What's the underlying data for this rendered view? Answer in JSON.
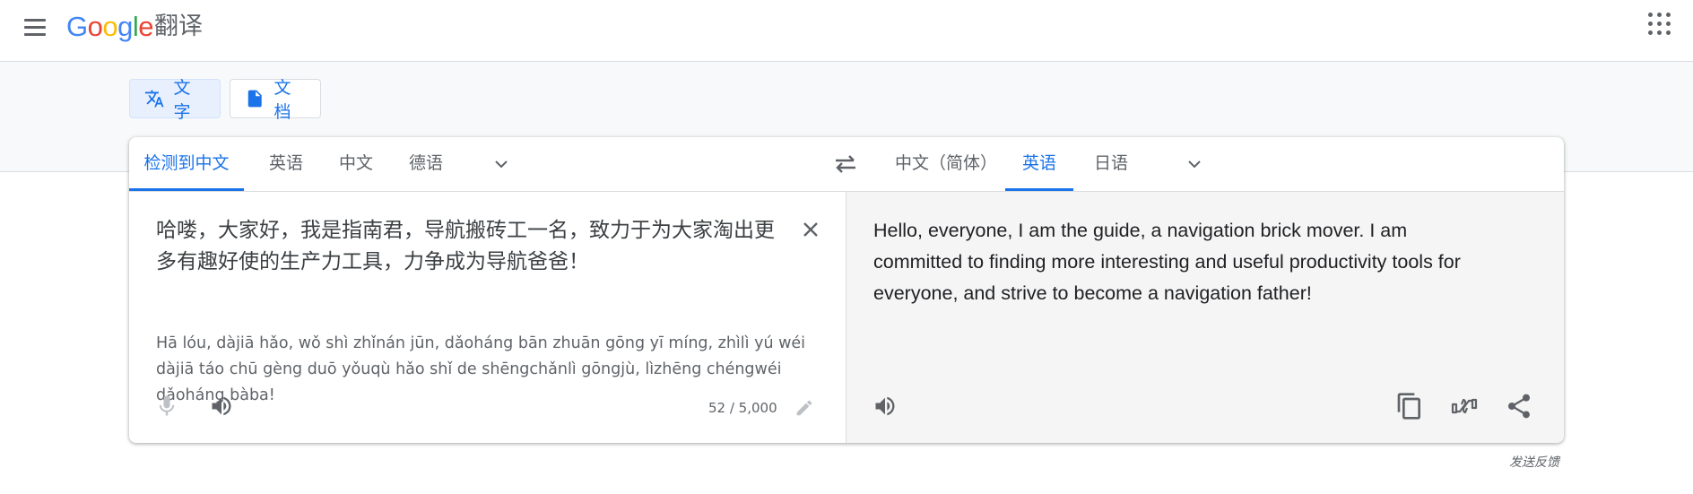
{
  "header": {
    "logo": {
      "g1": "G",
      "o1": "o",
      "o2": "o",
      "g2": "g",
      "l": "l",
      "e": "e"
    },
    "product_name": "翻译"
  },
  "modes": [
    {
      "label": "文字",
      "icon": "translate-icon",
      "active": true
    },
    {
      "label": "文档",
      "icon": "document-icon",
      "active": false
    }
  ],
  "source_langs": [
    {
      "label": "检测到中文",
      "active": true
    },
    {
      "label": "英语",
      "active": false
    },
    {
      "label": "中文",
      "active": false
    },
    {
      "label": "德语",
      "active": false
    }
  ],
  "target_langs": [
    {
      "label": "中文（简体）",
      "active": false
    },
    {
      "label": "英语",
      "active": true
    },
    {
      "label": "日语",
      "active": false
    }
  ],
  "source": {
    "text": "哈喽，大家好，我是指南君，导航搬砖工一名，致力于为大家淘出更多有趣好使的生产力工具，力争成为导航爸爸！",
    "transliteration": "Hā lóu, dàjiā hǎo, wǒ shì zhǐnán jūn, dǎoháng bān zhuān gōng yī míng, zhìlì yú wéi dàjiā táo chū gèng duō yǒuqù hǎo shǐ de shēngchǎnlì gōngjù, lìzhēng chéngwéi dǎoháng bàba!",
    "char_count": "52 / 5,000"
  },
  "target": {
    "text": "Hello, everyone, I am the guide, a navigation brick mover. I am committed to finding more interesting and useful productivity tools for everyone, and strive to become a navigation father!"
  },
  "footer": {
    "feedback": "发送反馈"
  },
  "colors": {
    "accent": "#1a73e8",
    "icon": "#5f6368",
    "target_bg": "#f5f5f5"
  }
}
